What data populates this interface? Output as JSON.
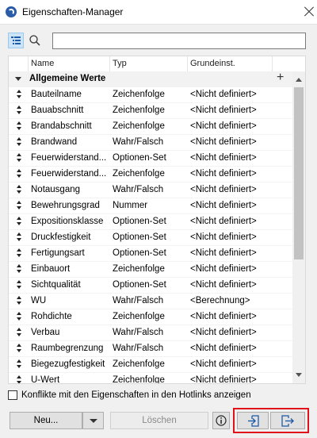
{
  "window": {
    "title": "Eigenschaften-Manager"
  },
  "search": {
    "value": "",
    "placeholder": ""
  },
  "columns": {
    "name": "Name",
    "type": "Typ",
    "default": "Grundeinst."
  },
  "group": {
    "label": "Allgemeine Werte",
    "add_symbol": "+"
  },
  "rows": [
    {
      "name": "Bauteilname",
      "type": "Zeichenfolge",
      "default": "<Nicht definiert>"
    },
    {
      "name": "Bauabschnitt",
      "type": "Zeichenfolge",
      "default": "<Nicht definiert>"
    },
    {
      "name": "Brandabschnitt",
      "type": "Zeichenfolge",
      "default": "<Nicht definiert>"
    },
    {
      "name": "Brandwand",
      "type": "Wahr/Falsch",
      "default": "<Nicht definiert>"
    },
    {
      "name": "Feuerwiderstand...",
      "type": "Optionen-Set",
      "default": "<Nicht definiert>"
    },
    {
      "name": "Feuerwiderstand...",
      "type": "Zeichenfolge",
      "default": "<Nicht definiert>"
    },
    {
      "name": "Notausgang",
      "type": "Wahr/Falsch",
      "default": "<Nicht definiert>"
    },
    {
      "name": "Bewehrungsgrad",
      "type": "Nummer",
      "default": "<Nicht definiert>"
    },
    {
      "name": "Expositionsklasse",
      "type": "Optionen-Set",
      "default": "<Nicht definiert>"
    },
    {
      "name": "Druckfestigkeit",
      "type": "Optionen-Set",
      "default": "<Nicht definiert>"
    },
    {
      "name": "Fertigungsart",
      "type": "Optionen-Set",
      "default": "<Nicht definiert>"
    },
    {
      "name": "Einbauort",
      "type": "Zeichenfolge",
      "default": "<Nicht definiert>"
    },
    {
      "name": "Sichtqualität",
      "type": "Optionen-Set",
      "default": "<Nicht definiert>"
    },
    {
      "name": "WU",
      "type": "Wahr/Falsch",
      "default": "<Berechnung>"
    },
    {
      "name": "Rohdichte",
      "type": "Zeichenfolge",
      "default": "<Nicht definiert>"
    },
    {
      "name": "Verbau",
      "type": "Wahr/Falsch",
      "default": "<Nicht definiert>"
    },
    {
      "name": "Raumbegrenzung",
      "type": "Wahr/Falsch",
      "default": "<Nicht definiert>"
    },
    {
      "name": "Biegezugfestigkeit",
      "type": "Zeichenfolge",
      "default": "<Nicht definiert>"
    },
    {
      "name": "U-Wert",
      "type": "Zeichenfolge",
      "default": "<Nicht definiert>"
    }
  ],
  "footer": {
    "checkbox_label": "Konflikte mit den Eigenschaften in den Hotlinks anzeigen",
    "checkbox_checked": false,
    "new_label": "Neu...",
    "delete_label": "Löschen"
  },
  "icons": {
    "app": "archicad-icon",
    "list_view": "list-view-icon",
    "search": "search-icon",
    "info": "info-icon",
    "import": "import-icon",
    "export": "export-icon"
  },
  "colors": {
    "highlight": "#e0111a",
    "list_toggle_bg": "#cce4f7"
  }
}
